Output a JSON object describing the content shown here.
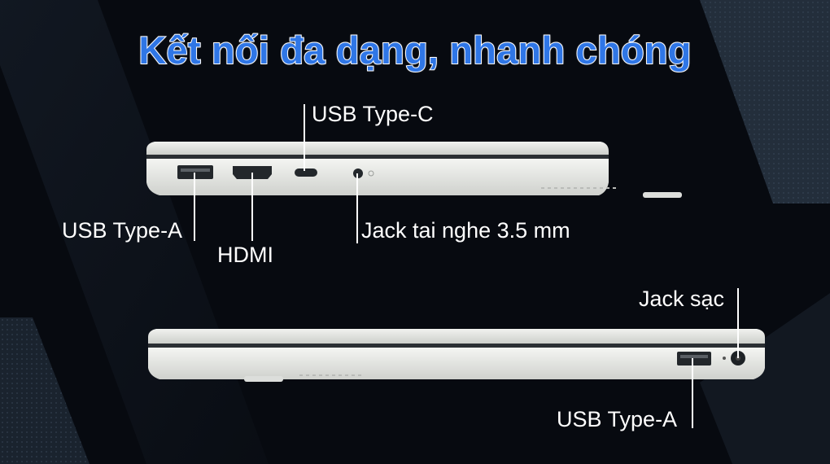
{
  "title": "Kết nối đa dạng, nhanh chóng",
  "ports_left_side": {
    "usb_c": "USB Type-C",
    "usb_a": "USB Type-A",
    "hdmi": "HDMI",
    "audio_jack": "Jack tai nghe 3.5 mm"
  },
  "ports_right_side": {
    "charging_jack": "Jack sạc",
    "usb_a": "USB Type-A"
  },
  "colors": {
    "background": "#070a10",
    "title_fill": "#2f76e6",
    "label_text": "#ffffff",
    "laptop_body": "#e4e5e2"
  }
}
